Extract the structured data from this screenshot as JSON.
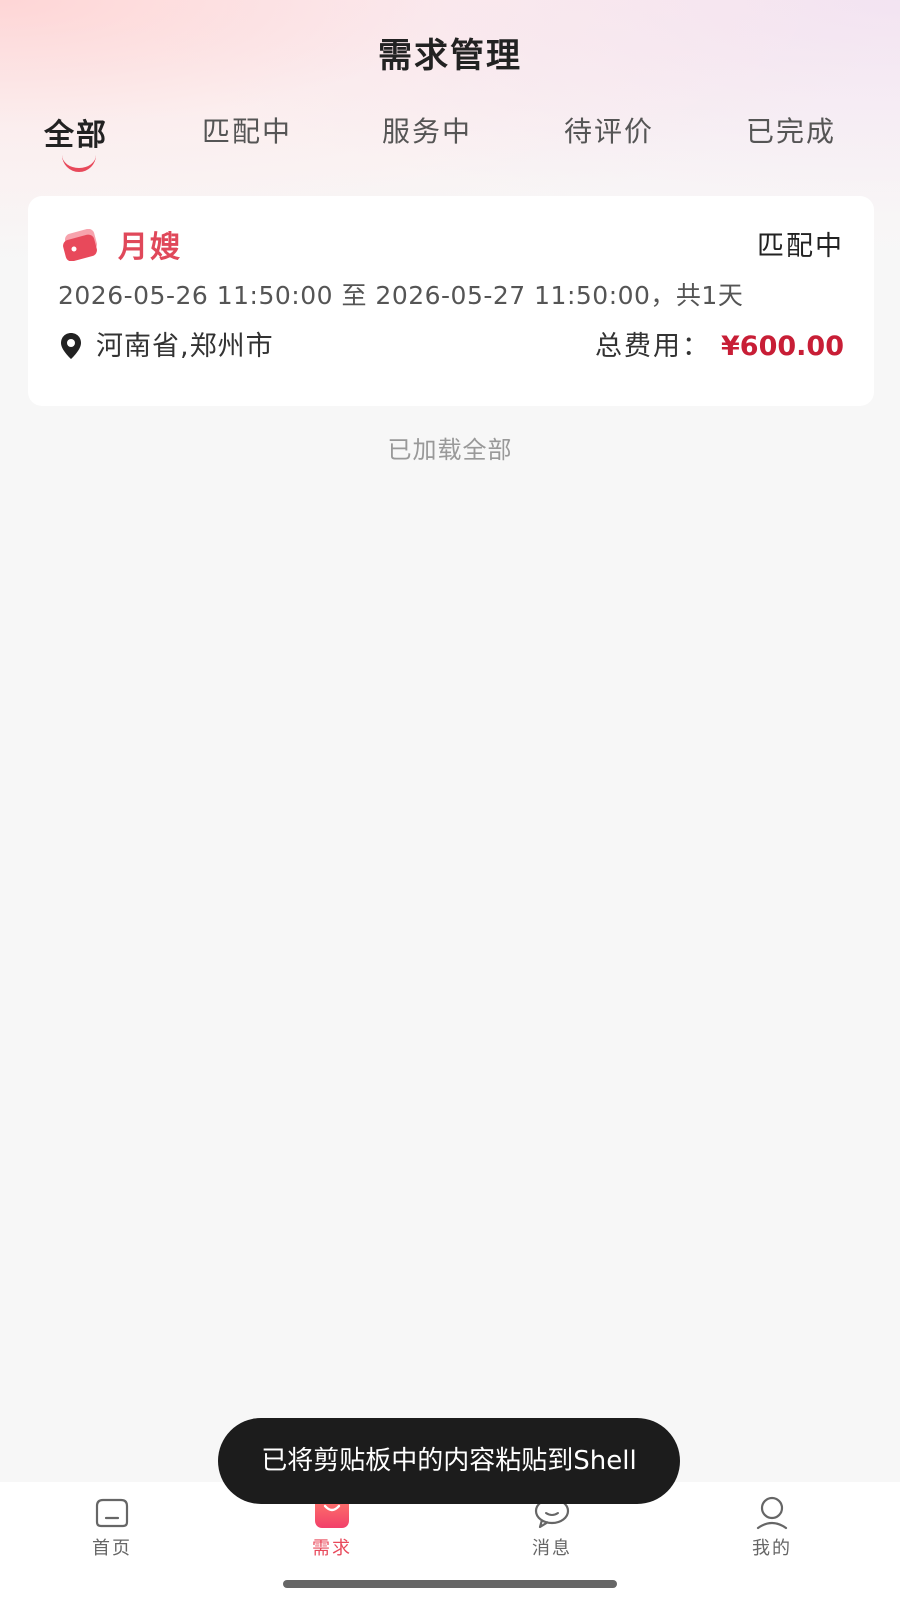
{
  "header": {
    "title": "需求管理"
  },
  "tabs": [
    {
      "label": "全部",
      "active": true
    },
    {
      "label": "匹配中",
      "active": false
    },
    {
      "label": "服务中",
      "active": false
    },
    {
      "label": "待评价",
      "active": false
    },
    {
      "label": "已完成",
      "active": false
    }
  ],
  "orders": [
    {
      "service_name": "月嫂",
      "status": "匹配中",
      "date_range": "2026-05-26 11:50:00 至 2026-05-27 11:50:00，共1天",
      "location": "河南省,郑州市",
      "fee_label": "总费用：",
      "fee_value": "¥600.00"
    }
  ],
  "list_footer": "已加载全部",
  "toast": "已将剪贴板中的内容粘贴到Shell",
  "bottom_nav": [
    {
      "label": "首页",
      "icon": "home-icon",
      "active": false
    },
    {
      "label": "需求",
      "icon": "bag-icon",
      "active": true
    },
    {
      "label": "消息",
      "icon": "message-icon",
      "active": false
    },
    {
      "label": "我的",
      "icon": "profile-icon",
      "active": false
    }
  ],
  "colors": {
    "accent": "#e8495b",
    "price": "#c81e36",
    "toast_bg": "#1c1c1c"
  }
}
